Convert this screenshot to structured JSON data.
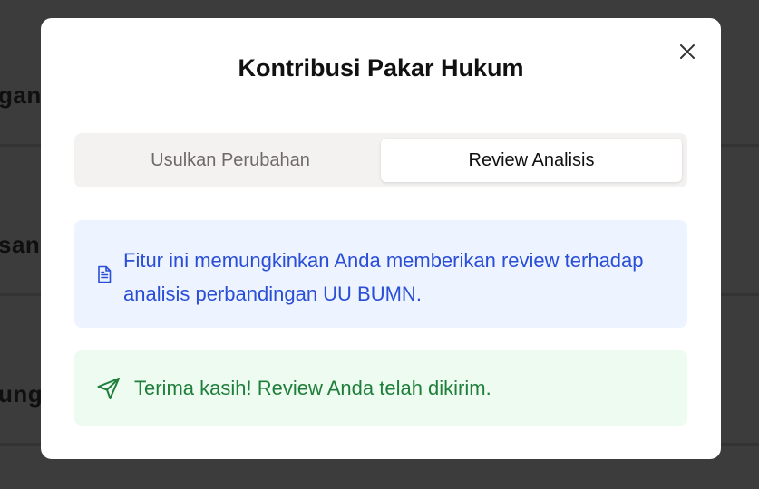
{
  "background": {
    "rows": [
      {
        "text": "gan"
      },
      {
        "text": "san"
      },
      {
        "text": "ung"
      }
    ]
  },
  "modal": {
    "title": "Kontribusi Pakar Hukum",
    "close_icon": "close-icon",
    "tabs": [
      {
        "label": "Usulkan Perubahan",
        "active": false
      },
      {
        "label": "Review Analisis",
        "active": true
      }
    ],
    "info": {
      "icon": "document-icon",
      "text": "Fitur ini memungkinkan Anda memberikan review terhadap analisis perbandingan UU BUMN."
    },
    "success": {
      "icon": "send-icon",
      "text": "Terima kasih! Review Anda telah dikirim."
    }
  },
  "colors": {
    "backdrop": "#3c3c3c",
    "info_bg": "#eef4ff",
    "info_text": "#2a4ed6",
    "success_bg": "#edfbf1",
    "success_text": "#1f7f3a"
  }
}
